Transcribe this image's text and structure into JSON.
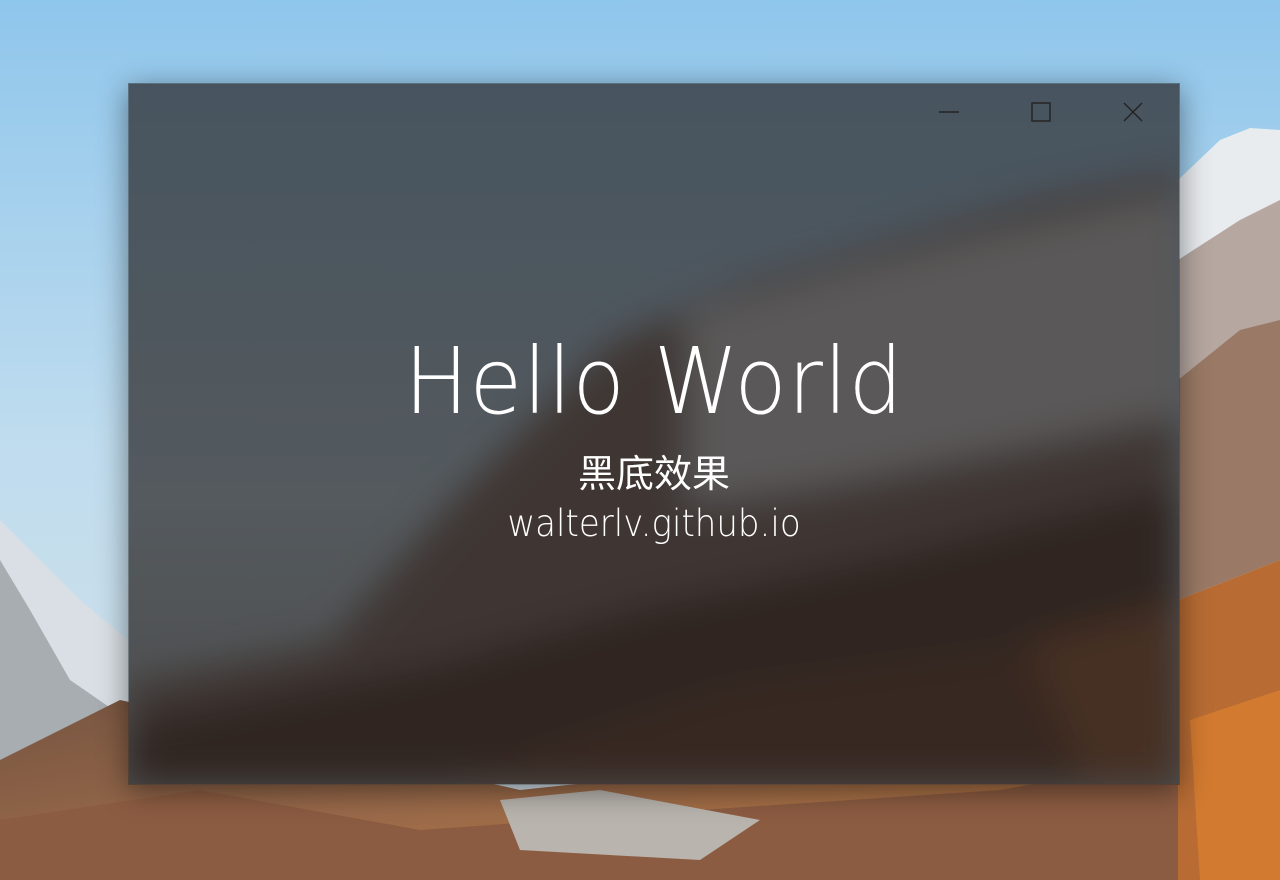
{
  "window": {
    "title": "Hello World",
    "subtitle": "黑底效果",
    "url": "walterlv.github.io"
  },
  "caption_buttons": [
    {
      "name": "minimize",
      "icon": "minimize-icon"
    },
    {
      "name": "maximize",
      "icon": "maximize-icon"
    },
    {
      "name": "close",
      "icon": "close-icon"
    }
  ],
  "colors": {
    "text": "#ffffff",
    "tint": "#1c1c1e",
    "caption_glyph": "#222222"
  }
}
